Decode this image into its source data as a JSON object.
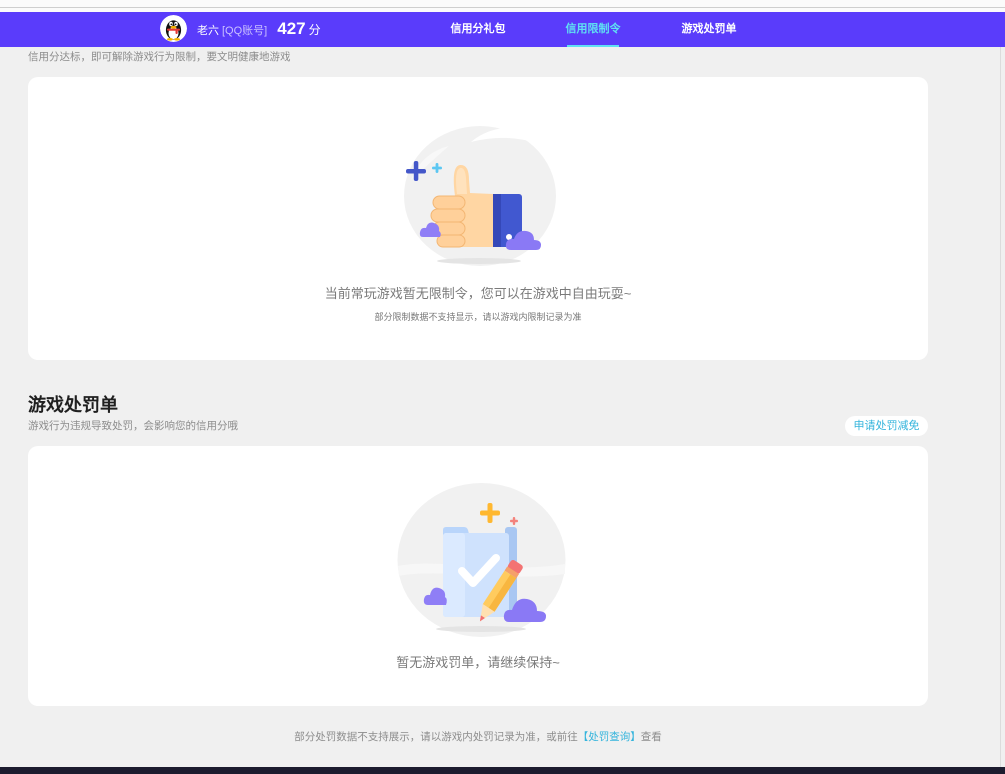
{
  "header": {
    "user_name": "老六",
    "account_type": "[QQ账号]",
    "score": "427",
    "score_unit": "分",
    "nav": [
      {
        "label": "信用分礼包",
        "active": false
      },
      {
        "label": "信用限制令",
        "active": true
      },
      {
        "label": "游戏处罚单",
        "active": false
      }
    ]
  },
  "restriction": {
    "subtitle": "信用分达标，即可解除游戏行为限制，要文明健康地游戏",
    "empty_text": "当前常玩游戏暂无限制令，您可以在游戏中自由玩耍~",
    "note": "部分限制数据不支持显示，请以游戏内限制记录为准"
  },
  "penalty": {
    "title": "游戏处罚单",
    "subtitle": "游戏行为违规导致处罚，会影响您的信用分哦",
    "appeal_button": "申请处罚减免",
    "empty_text": "暂无游戏罚单，请继续保持~"
  },
  "footer": {
    "note_prefix": "部分处罚数据不支持展示，请以游戏内处罚记录为准，或前往",
    "link": "【处罚查询】",
    "note_suffix": "查看"
  },
  "icons": {
    "avatar": "qq-penguin-avatar",
    "restriction_illustration": "thumbs-up-illustration",
    "penalty_illustration": "clipboard-check-illustration"
  },
  "colors": {
    "header_bg": "#5a3cfb",
    "active_nav": "#5fe1f3",
    "link": "#34b4dc",
    "page_bg": "#f0f0f0",
    "footer_bar": "#1c1b2e"
  }
}
